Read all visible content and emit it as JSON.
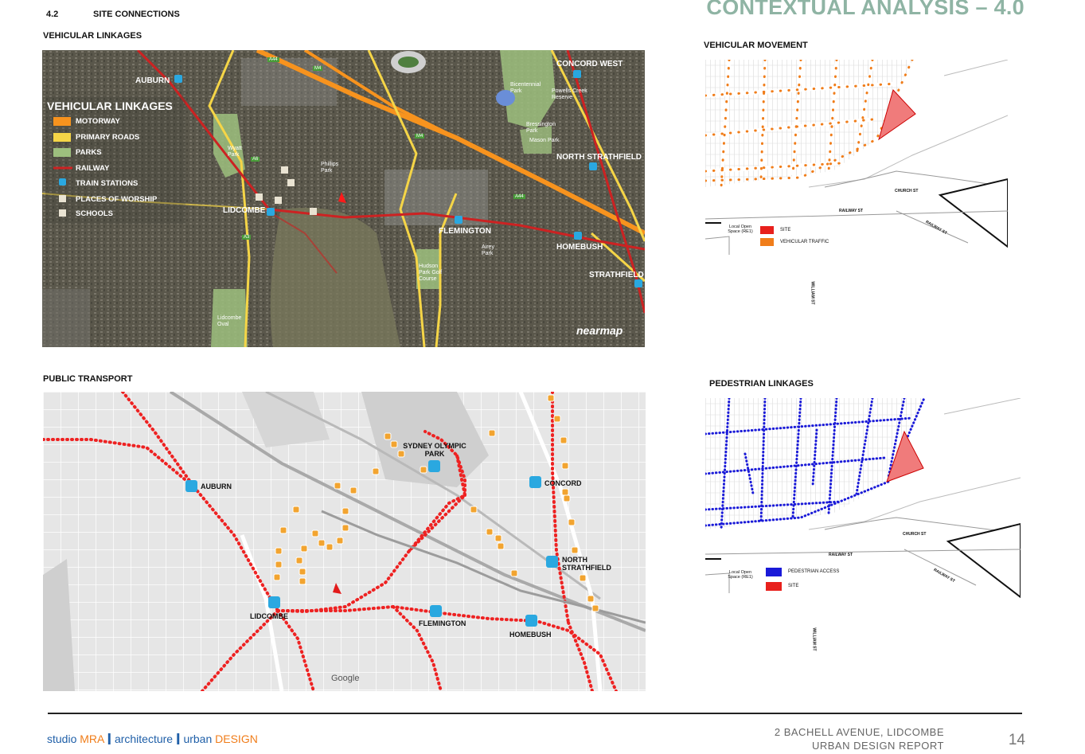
{
  "header": {
    "section_number": "4.2",
    "section_title": "SITE CONNECTIONS",
    "doc_title": "CONTEXTUAL ANALYSIS – 4.0"
  },
  "panels": {
    "vehicular_linkages": {
      "title": "VEHICULAR LINKAGES",
      "legend_title": "VEHICULAR LINKAGES",
      "legend": [
        {
          "label": "MOTORWAY",
          "color": "#f7931e"
        },
        {
          "label": "PRIMARY ROADS",
          "color": "#f5d547"
        },
        {
          "label": "PARKS",
          "color": "#9dbf7e"
        },
        {
          "label": "RAILWAY",
          "color": "#cc2222"
        },
        {
          "label": "TRAIN STATIONS",
          "icon": "train-icon"
        },
        {
          "label": "PLACES OF WORSHIP",
          "icon": "worship-icon"
        },
        {
          "label": "SCHOOLS",
          "icon": "school-icon"
        }
      ],
      "stations": [
        "AUBURN",
        "LIDCOMBE",
        "FLEMINGTON",
        "HOMEBUSH",
        "STRATHFIELD",
        "NORTH STRATHFIELD",
        "CONCORD WEST"
      ],
      "places": [
        "Bicentennial Park",
        "Powells Creek Reserve",
        "Bressington Park",
        "Mason Park",
        "Wyatt Park",
        "Phillips Park",
        "Hudson Park Golf Course",
        "Airey Park",
        "Lidcombe Oval"
      ],
      "road_badges": [
        "A44",
        "M4",
        "M4",
        "A44",
        "A6",
        "A3"
      ],
      "watermark": "nearmap"
    },
    "public_transport": {
      "title": "PUBLIC TRANSPORT",
      "stations": [
        "AUBURN",
        "LIDCOMBE",
        "FLEMINGTON",
        "HOMEBUSH",
        "NORTH STRATHFIELD",
        "CONCORD",
        "SYDNEY OLYMPIC PARK"
      ],
      "watermark": "Google"
    },
    "vehicular_movement": {
      "title": "VEHICULAR MOVEMENT",
      "legend": [
        {
          "label": "SITE",
          "color": "#e8201c"
        },
        {
          "label": "VEHICULAR TRAFFIC",
          "color": "#f07d1a"
        }
      ],
      "open_space": "Local Open Space (RE1)",
      "streets": [
        "CHURCH ST",
        "RAILWAY ST",
        "RAILWAY ST",
        "WILLIAM ST"
      ]
    },
    "pedestrian_linkages": {
      "title": "PEDESTRIAN LINKAGES",
      "legend": [
        {
          "label": "PEDESTRIAN ACCESS",
          "color": "#1a1ad8"
        },
        {
          "label": "SITE",
          "color": "#e8201c"
        }
      ],
      "open_space": "Local Open Space (RE1)",
      "streets": [
        "CHURCH ST",
        "RAILWAY ST",
        "RAILWAY ST",
        "WILLIAM ST"
      ]
    }
  },
  "footer": {
    "brand_studio": "studio ",
    "brand_mra": "MRA",
    "brand_sep": "I",
    "brand_arch": "architecture",
    "brand_urban": "urban",
    "brand_design": "DESIGN",
    "address_line1": "2 BACHELL AVENUE, LIDCOMBE",
    "address_line2": "URBAN DESIGN REPORT",
    "page_number": "14"
  }
}
